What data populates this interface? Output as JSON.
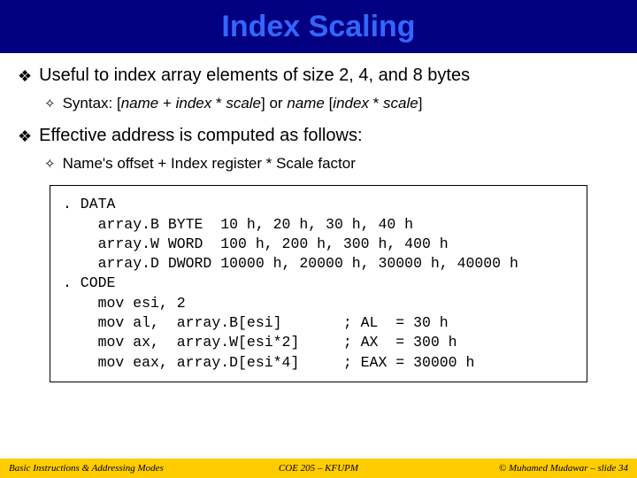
{
  "title": "Index Scaling",
  "bullets": {
    "b1": "Useful to index array elements of size 2, 4, and 8 bytes",
    "b1a_prefix": "Syntax: [",
    "b1a_n1": "name",
    "b1a_p1": " + ",
    "b1a_i1": "index",
    "b1a_p2": " * ",
    "b1a_s1": "scale",
    "b1a_mid": "] or ",
    "b1a_n2": "name",
    "b1a_p3": " [",
    "b1a_i2": "index",
    "b1a_p4": " * ",
    "b1a_s2": "scale",
    "b1a_end": "]",
    "b2": "Effective address is computed as follows:",
    "b2a": "Name's offset + Index register * Scale factor"
  },
  "code": ". DATA\n    array.B BYTE  10 h, 20 h, 30 h, 40 h\n    array.W WORD  100 h, 200 h, 300 h, 400 h\n    array.D DWORD 10000 h, 20000 h, 30000 h, 40000 h\n. CODE\n    mov esi, 2\n    mov al,  array.B[esi]       ; AL  = 30 h\n    mov ax,  array.W[esi*2]     ; AX  = 300 h\n    mov eax, array.D[esi*4]     ; EAX = 30000 h",
  "footer": {
    "left": "Basic Instructions & Addressing Modes",
    "center": "COE 205 – KFUPM",
    "right": "© Muhamed Mudawar – slide 34"
  }
}
